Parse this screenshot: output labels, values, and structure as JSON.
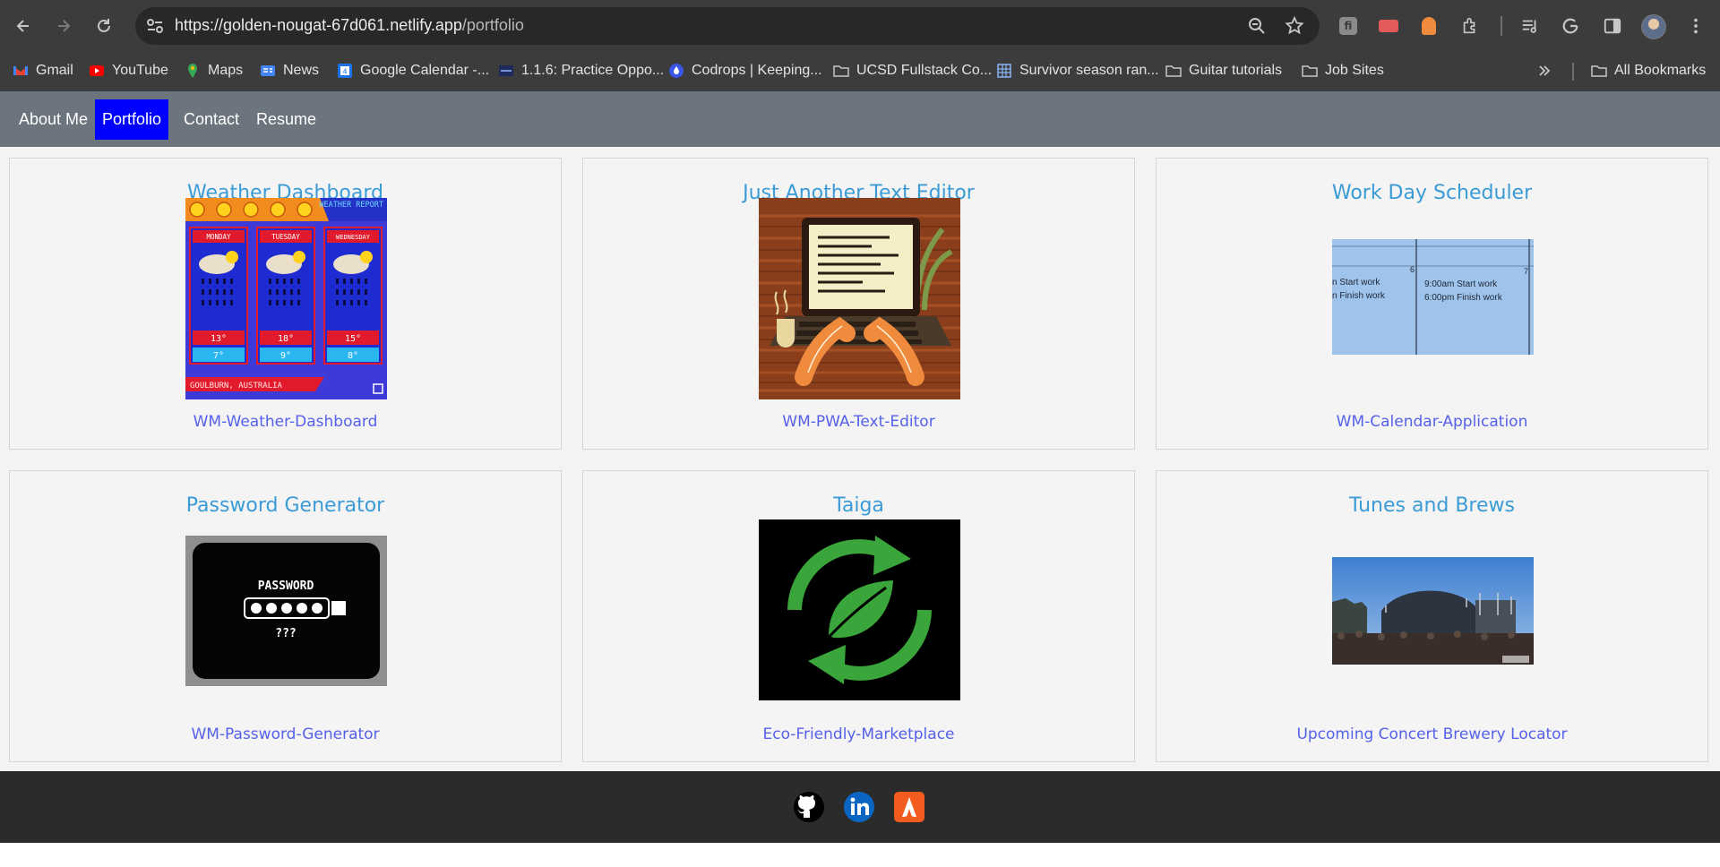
{
  "browser": {
    "url_host": "https://golden-nougat-67d061.netlify.app",
    "url_path": "/portfolio",
    "bookmarks": [
      {
        "label": "Gmail",
        "icon": "gmail-icon"
      },
      {
        "label": "YouTube",
        "icon": "youtube-icon"
      },
      {
        "label": "Maps",
        "icon": "maps-icon"
      },
      {
        "label": "News",
        "icon": "news-icon"
      },
      {
        "label": "Google Calendar -...",
        "icon": "calendar-icon"
      },
      {
        "label": "1.1.6: Practice Oppo...",
        "icon": "course-icon"
      },
      {
        "label": "Codrops | Keeping...",
        "icon": "codrops-icon"
      },
      {
        "label": "UCSD Fullstack Co...",
        "icon": "folder-icon"
      },
      {
        "label": "Survivor season ran...",
        "icon": "sheet-icon"
      },
      {
        "label": "Guitar tutorials",
        "icon": "folder-icon"
      },
      {
        "label": "Job Sites",
        "icon": "folder-icon"
      }
    ],
    "all_bookmarks": "All Bookmarks"
  },
  "nav": {
    "items": [
      {
        "label": "About Me",
        "active": false
      },
      {
        "label": "Portfolio",
        "active": true
      },
      {
        "label": "Contact",
        "active": false
      },
      {
        "label": "Resume",
        "active": false
      }
    ]
  },
  "projects": [
    {
      "title": "Weather Dashboard",
      "link": "WM-Weather-Dashboard",
      "image": "weather-report-image",
      "weather": {
        "header": "WEATHER REPORT",
        "days": [
          "MONDAY",
          "TUESDAY",
          "WEDNESDAY"
        ],
        "highs": [
          "13°",
          "18°",
          "15°"
        ],
        "lows": [
          "7°",
          "9°",
          "8°"
        ],
        "location": "GOULBURN, AUSTRALIA"
      }
    },
    {
      "title": "Just Another Text Editor",
      "link": "WM-PWA-Text-Editor",
      "image": "typing-laptop-image"
    },
    {
      "title": "Work Day Scheduler",
      "link": "WM-Calendar-Application",
      "image": "calendar-image",
      "calendar": {
        "day_a": "6",
        "day_b": "7",
        "left_lines": [
          "n  Start work",
          "n  Finish work"
        ],
        "right_lines": [
          "9:00am  Start work",
          "6:00pm  Finish work"
        ]
      }
    },
    {
      "title": "Password Generator",
      "link": "WM-Password-Generator",
      "image": "password-image",
      "password": {
        "label": "PASSWORD",
        "hint": "???"
      }
    },
    {
      "title": "Taiga",
      "link": "Eco-Friendly-Marketplace",
      "image": "recycle-leaf-image"
    },
    {
      "title": "Tunes and Brews",
      "link": "Upcoming Concert Brewery Locator",
      "image": "concert-image"
    }
  ],
  "footer": {
    "icons": [
      "github-icon",
      "linkedin-icon",
      "stackoverflow-icon"
    ]
  },
  "colors": {
    "nav_bg": "#6c757d",
    "nav_active": "#0000ff",
    "card_title": "#3b9bd6",
    "card_link": "#5561e9",
    "footer_bg": "#2b2b2b"
  }
}
